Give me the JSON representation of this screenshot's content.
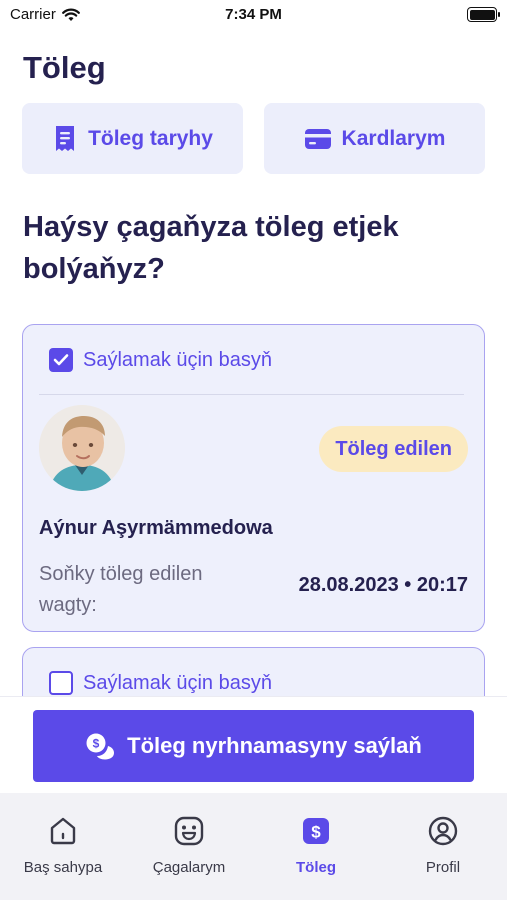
{
  "status_bar": {
    "carrier": "Carrier",
    "time": "7:34 PM"
  },
  "page": {
    "title": "Töleg"
  },
  "top_buttons": {
    "history": "Töleg taryhy",
    "cards": "Kardlarym"
  },
  "question": "Haýsy çagaňyza töleg etjek bolýaňyz?",
  "children": [
    {
      "select_label": "Saýlamak üçin basyň",
      "checked": true,
      "status": "Töleg edilen",
      "name": "Aýnur Aşyrmämmedowa",
      "last_payment_label": "Soňky töleg edilen wagty:",
      "last_payment_value": "28.08.2023 • 20:17"
    },
    {
      "select_label": "Saýlamak üçin basyň",
      "checked": false
    }
  ],
  "action": {
    "pay_button": "Töleg nyrhnamasyny saýlaň"
  },
  "tabs": [
    {
      "label": "Baş sahypa",
      "icon": "home-icon",
      "active": false
    },
    {
      "label": "Çagalarym",
      "icon": "smile-icon",
      "active": false
    },
    {
      "label": "Töleg",
      "icon": "dollar-icon",
      "active": true
    },
    {
      "label": "Profil",
      "icon": "user-icon",
      "active": false
    }
  ],
  "colors": {
    "accent": "#5b4ae8",
    "card_bg": "#eef0fc",
    "badge_bg": "#fbeac0",
    "title": "#25214f"
  }
}
